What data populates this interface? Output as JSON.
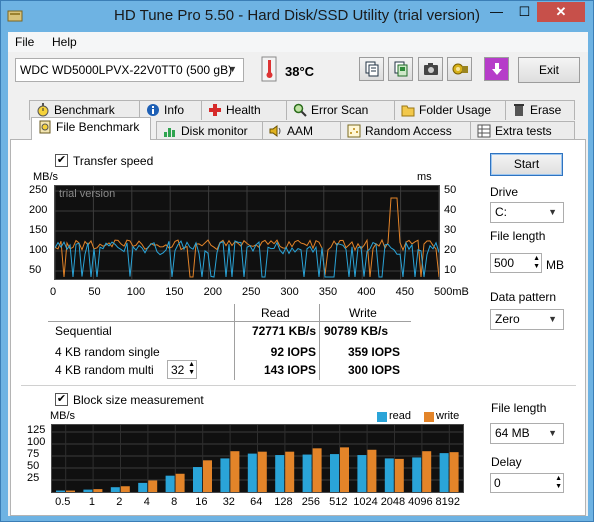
{
  "window": {
    "title": "HD Tune Pro 5.50 - Hard Disk/SSD Utility (trial version)",
    "min": "—",
    "max": "☐",
    "close": "✕"
  },
  "menu": {
    "file": "File",
    "help": "Help"
  },
  "toolbar": {
    "drive": "WDC WD5000LPVX-22V0TT0 (500 gB)",
    "temperature": "38°C",
    "exit": "Exit"
  },
  "tabs_top": [
    "Benchmark",
    "Info",
    "Health",
    "Error Scan",
    "Folder Usage",
    "Erase"
  ],
  "tabs_bottom": [
    "File Benchmark",
    "Disk monitor",
    "AAM",
    "Random Access",
    "Extra tests"
  ],
  "transfer": {
    "checkbox_label": "Transfer speed",
    "unit_left": "MB/s",
    "unit_right": "ms",
    "watermark": "trial version",
    "y_left": [
      "250",
      "200",
      "150",
      "100",
      "50"
    ],
    "y_right": [
      "50",
      "40",
      "30",
      "20",
      "10"
    ],
    "x_ticks": [
      "0",
      "50",
      "100",
      "150",
      "200",
      "250",
      "300",
      "350",
      "400",
      "450",
      "500mB"
    ]
  },
  "results": {
    "col_read": "Read",
    "col_write": "Write",
    "rows": [
      {
        "label": "Sequential",
        "read": "72771 KB/s",
        "write": "90789 KB/s"
      },
      {
        "label": "4 KB random single",
        "read": "92 IOPS",
        "write": "359 IOPS"
      },
      {
        "label": "4 KB random multi",
        "read": "143 IOPS",
        "write": "300 IOPS"
      }
    ],
    "queue_depth": "32"
  },
  "block": {
    "checkbox_label": "Block size measurement",
    "unit": "MB/s",
    "legend_read": "read",
    "legend_write": "write",
    "y_ticks": [
      "125",
      "100",
      "75",
      "50",
      "25"
    ]
  },
  "side": {
    "start": "Start",
    "drive_label": "Drive",
    "drive_value": "C:",
    "file_length_label": "File length",
    "file_length_value": "500",
    "file_length_unit": "MB",
    "pattern_label": "Data pattern",
    "pattern_value": "Zero",
    "block_length_label": "File length",
    "block_length_value": "64 MB",
    "delay_label": "Delay",
    "delay_value": "0"
  },
  "chart_data": {
    "type": "bar",
    "categories": [
      "0.5",
      "1",
      "2",
      "4",
      "8",
      "16",
      "32",
      "64",
      "128",
      "256",
      "512",
      "1024",
      "2048",
      "4096",
      "8192"
    ],
    "series": [
      {
        "name": "read",
        "values": [
          3,
          5,
          10,
          19,
          34,
          52,
          70,
          80,
          77,
          78,
          79,
          77,
          70,
          72,
          81
        ]
      },
      {
        "name": "write",
        "values": [
          3,
          6,
          12,
          24,
          38,
          66,
          85,
          84,
          84,
          91,
          93,
          88,
          69,
          85,
          83
        ]
      }
    ],
    "ylabel": "MB/s",
    "ylim": [
      0,
      150
    ],
    "colors": {
      "read": "#2aa4d8",
      "write": "#e38429"
    }
  }
}
